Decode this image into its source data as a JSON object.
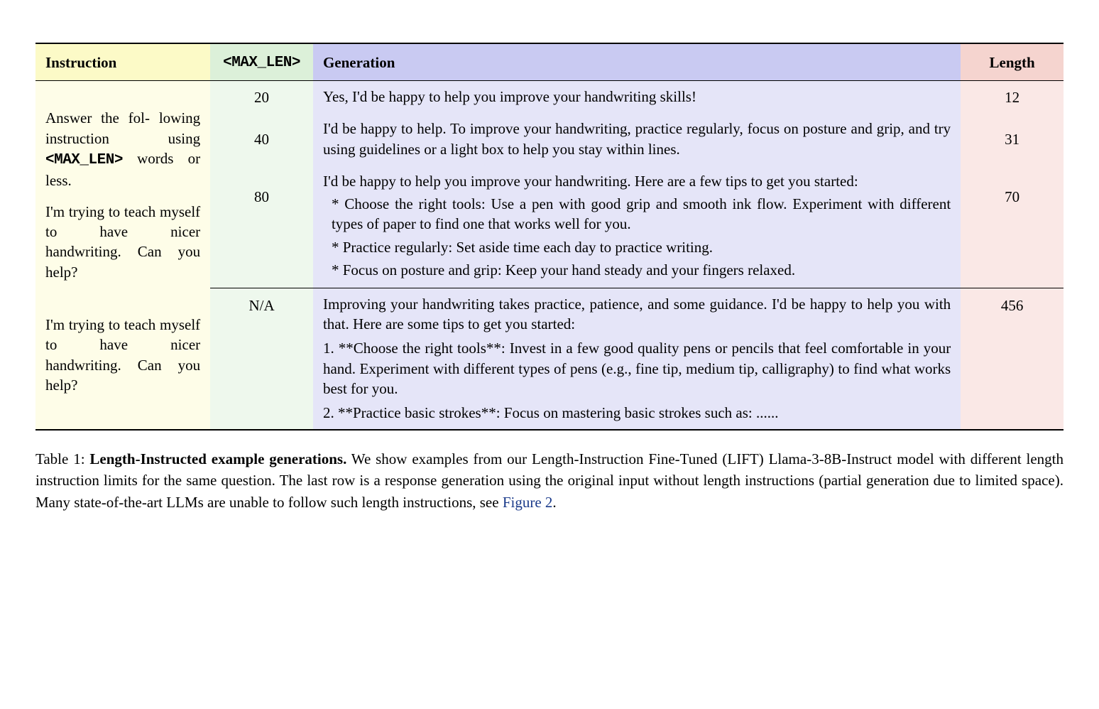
{
  "headers": {
    "instruction": "Instruction",
    "maxlen": "<MAX_LEN>",
    "generation": "Generation",
    "length": "Length"
  },
  "instruction_block1_line1": "Answer the fol-",
  "instruction_block1_line2": "lowing instruction using ",
  "instruction_block1_code": "<MAX_LEN>",
  "instruction_block1_line3": " words or less.",
  "instruction_block2": "I'm trying to teach myself to have nicer handwriting. Can you help?",
  "instruction_block3": "I'm trying to teach myself to have nicer handwriting. Can you help?",
  "rows": {
    "r1_maxlen": "20",
    "r1_gen": "Yes, I'd be happy to help you improve your handwriting skills!",
    "r1_len": "12",
    "r2_maxlen": "40",
    "r2_gen": "I'd be happy to help. To improve your handwriting, practice regularly, focus on posture and grip, and try using guidelines or a light box to help you stay within lines.",
    "r2_len": "31",
    "r3_maxlen": "80",
    "r3_gen_p1": "I'd be happy to help you improve your handwriting. Here are a few tips to get you started:",
    "r3_gen_b1": " * Choose the right tools: Use a pen with good grip and smooth ink flow. Experiment with different types of paper to find one that works well for you.",
    "r3_gen_b2": " * Practice regularly: Set aside time each day to practice writing.",
    "r3_gen_b3": " * Focus on posture and grip: Keep your hand steady and your fingers relaxed.",
    "r3_len": "70",
    "r4_maxlen": "N/A",
    "r4_gen_p1": "Improving your handwriting takes practice, patience, and some guidance. I'd be happy to help you with that. Here are some tips to get you started:",
    "r4_gen_p2": "1. **Choose the right tools**: Invest in a few good quality pens or pencils that feel comfortable in your hand. Experiment with different types of pens (e.g., fine tip, medium tip, calligraphy) to find what works best for you.",
    "r4_gen_p3": "2. **Practice basic strokes**: Focus on mastering basic strokes such as: ......",
    "r4_len": "456"
  },
  "caption": {
    "label": "Table 1: ",
    "title": "Length-Instructed example generations.",
    "body": " We show examples from our Length-Instruction Fine-Tuned (LIFT) Llama-3-8B-Instruct model with different length instruction limits for the same question. The last row is a response generation using the original input without length instructions (partial generation due to limited space). Many state-of-the-art LLMs are unable to follow such length instructions, see ",
    "figlink": "Figure 2",
    "period": "."
  }
}
